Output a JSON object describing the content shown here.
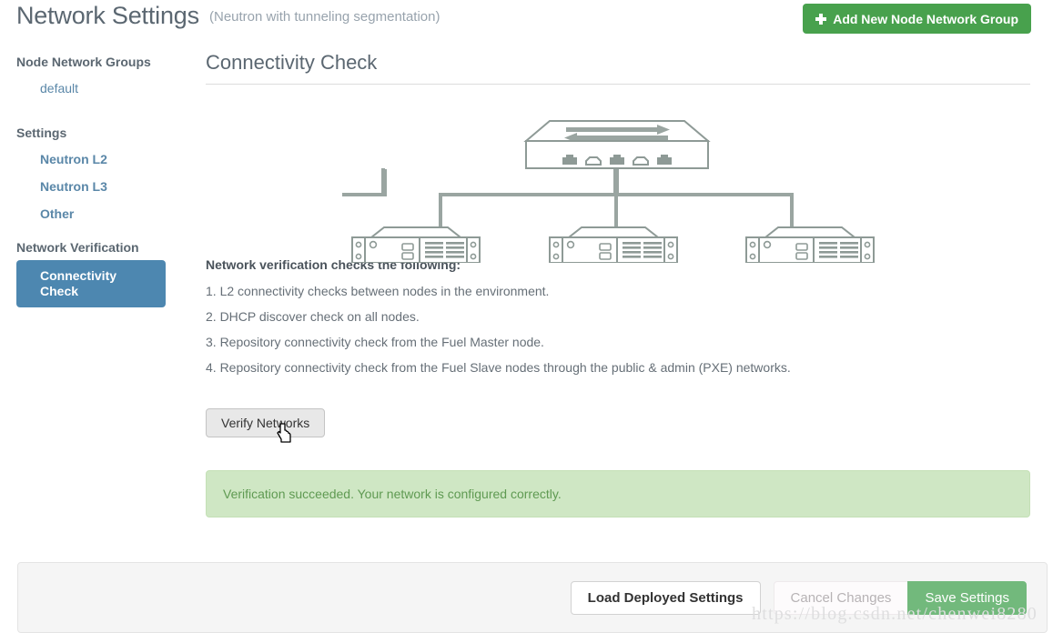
{
  "header": {
    "title": "Network Settings",
    "subtitle": "(Neutron with tunneling segmentation)",
    "add_button_label": "Add New Node Network Group",
    "add_button_icon": "plus-icon",
    "accent_green": "#48a14d"
  },
  "sidebar": {
    "groups": [
      {
        "title": "Node Network Groups",
        "items": [
          {
            "label": "default",
            "active": false
          }
        ]
      },
      {
        "title": "Settings",
        "items": [
          {
            "label": "Neutron L2",
            "active": false
          },
          {
            "label": "Neutron L3",
            "active": false
          },
          {
            "label": "Other",
            "active": false
          }
        ]
      },
      {
        "title": "Network Verification",
        "items": [
          {
            "label": "Connectivity Check",
            "active": true
          }
        ]
      }
    ],
    "active_color": "#4d87b0",
    "link_color": "#5a87a8"
  },
  "main": {
    "section_title": "Connectivity Check",
    "diagram": {
      "name": "network-topology-diagram",
      "stroke_color": "#8e9a96",
      "switch_ports": 5,
      "server_count": 3
    },
    "verification_heading": "Network verification checks the following:",
    "verification_items": [
      "1. L2 connectivity checks between nodes in the environment.",
      "2. DHCP discover check on all nodes.",
      "3. Repository connectivity check from the Fuel Master node.",
      "4. Repository connectivity check from the Fuel Slave nodes through the public & admin (PXE) networks."
    ],
    "verify_button_label": "Verify Networks",
    "alert": {
      "message": "Verification succeeded. Your network is configured correctly.",
      "background": "#cfe7c4",
      "text_color": "#5f9a52"
    }
  },
  "footer": {
    "load_label": "Load Deployed Settings",
    "cancel_label": "Cancel Changes",
    "save_label": "Save Settings"
  },
  "watermark": "https://blog.csdn.net/chenwei8280"
}
